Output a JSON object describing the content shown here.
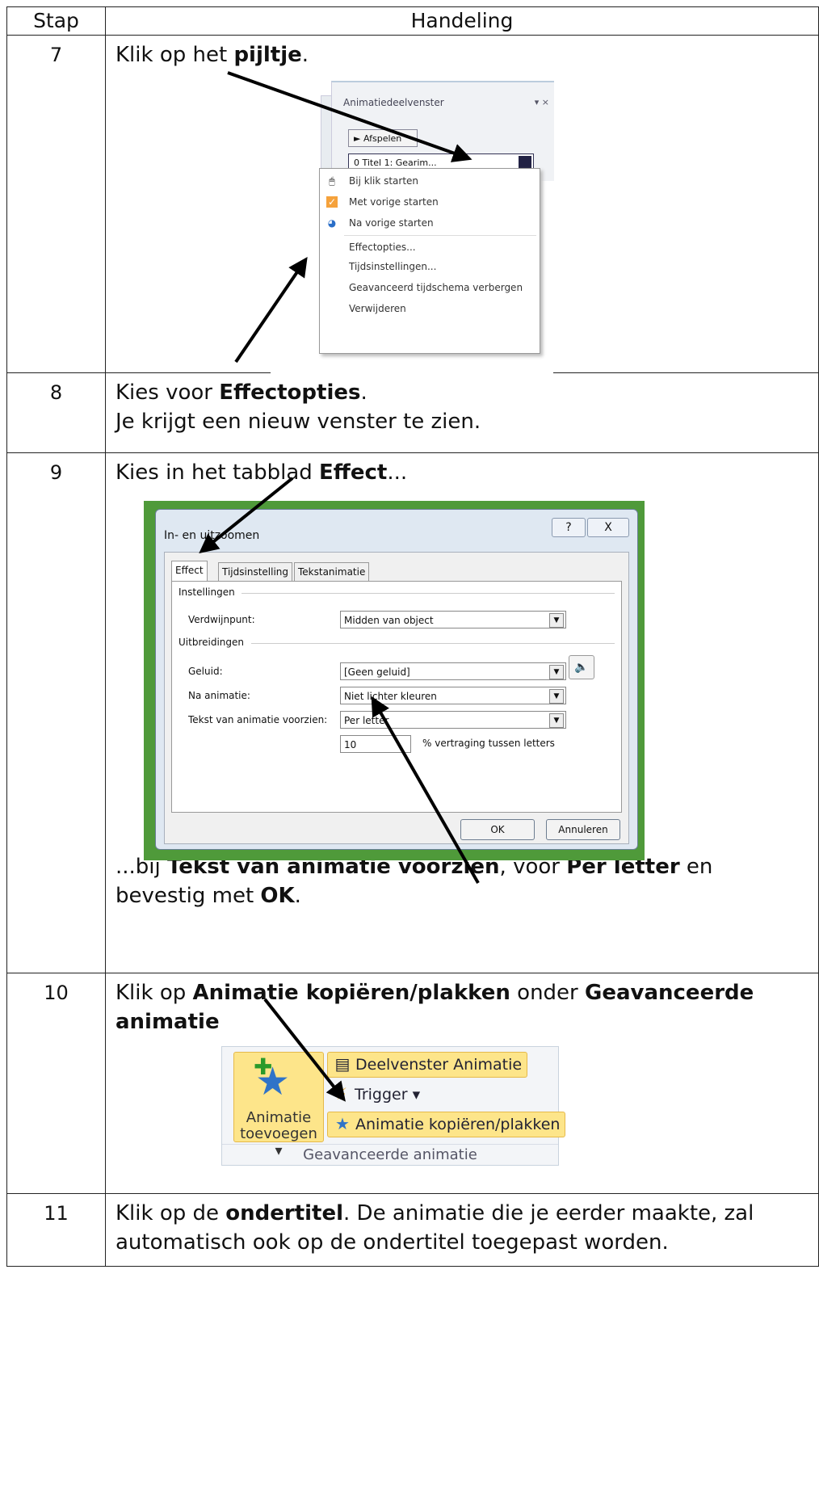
{
  "table": {
    "header_stap": "Stap",
    "header_handeling": "Handeling"
  },
  "step7": {
    "num": "7",
    "text_pre": "Klik op het ",
    "text_bold": "pijltje",
    "text_post": ".",
    "menu_shot": {
      "pane_title": "Animatiedeelvenster",
      "pane_close": "▾ ×",
      "play_label": "Afspelen",
      "item_label": "0 Titel 1: Gearim...",
      "menu_items": [
        "Bij klik starten",
        "Met vorige starten",
        "Na vorige starten",
        "Effectopties...",
        "Tijdsinstellingen...",
        "Geavanceerd tijdschema verbergen",
        "Verwijderen"
      ]
    }
  },
  "step8": {
    "num": "8",
    "line1_pre": "Kies voor ",
    "line1_bold": "Effectopties",
    "line1_post": ".",
    "line2": "Je krijgt een nieuw venster te zien."
  },
  "step9": {
    "num": "9",
    "text_pre": "Kies in het tabblad ",
    "text_bold": "Effect",
    "text_post": "...",
    "dialog": {
      "title": "In- en uitzoomen",
      "help": "?",
      "close": "X",
      "tabs": [
        "Effect",
        "Tijdsinstelling",
        "Tekstanimatie"
      ],
      "group_settings": "Instellingen",
      "label_vanishing": "Verdwijnpunt:",
      "value_vanishing": "Midden van object",
      "group_extensions": "Uitbreidingen",
      "label_sound": "Geluid:",
      "value_sound": "[Geen geluid]",
      "label_after": "Na animatie:",
      "value_after": "Niet lichter kleuren",
      "label_text": "Tekst van animatie voorzien:",
      "value_text": "Per letter",
      "delay_value": "10",
      "delay_label": "% vertraging tussen letters",
      "ok": "OK",
      "cancel": "Annuleren"
    },
    "bottom_pre": "...bij ",
    "bottom_b1": "Tekst van animatie voorzien",
    "bottom_mid1": ", voor ",
    "bottom_b2": "Per letter",
    "bottom_mid2": " en bevestig met ",
    "bottom_b3": "OK",
    "bottom_post": "."
  },
  "step10": {
    "num": "10",
    "text_pre": "Klik op ",
    "text_b1": "Animatie kopiëren/plakken",
    "text_mid": " onder ",
    "text_b2": "Geavanceerde animatie",
    "ribbon": {
      "big_label1": "Animatie",
      "big_label2": "toevoegen ▾",
      "btn_pane": "Deelvenster Animatie",
      "btn_trigger": "Trigger ▾",
      "btn_copy": "Animatie kopiëren/plakken",
      "group_name": "Geavanceerde animatie"
    }
  },
  "step11": {
    "num": "11",
    "text_pre": "Klik op de ",
    "text_bold": "ondertitel",
    "text_post": ". De animatie die je eerder maakte, zal automatisch ook op de ondertitel toegepast worden."
  }
}
